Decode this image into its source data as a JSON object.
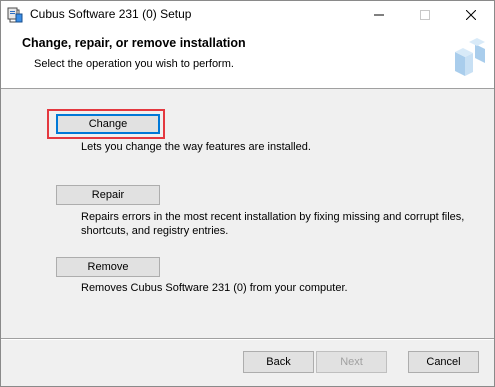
{
  "window": {
    "title": "Cubus Software 231 (0) Setup",
    "icon": "installer-icon",
    "controls": {
      "minimize": "minimize-icon",
      "maximize": "maximize-icon",
      "close": "close-icon"
    }
  },
  "header": {
    "title": "Change, repair, or remove installation",
    "subtitle": "Select the operation you wish to perform.",
    "logo": "setup-banner-icon"
  },
  "options": [
    {
      "label": "Change",
      "description": "Lets you change the way features are installed."
    },
    {
      "label": "Repair",
      "description": "Repairs errors in the most recent installation by fixing missing and corrupt files, shortcuts, and registry entries."
    },
    {
      "label": "Remove",
      "description": "Removes Cubus Software 231 (0) from your computer."
    }
  ],
  "footer": {
    "back_label": "Back",
    "next_label": "Next",
    "cancel_label": "Cancel"
  },
  "colors": {
    "highlight": "#e4383f",
    "focus": "#0078d7",
    "logo_blue": "#a9cdec"
  }
}
